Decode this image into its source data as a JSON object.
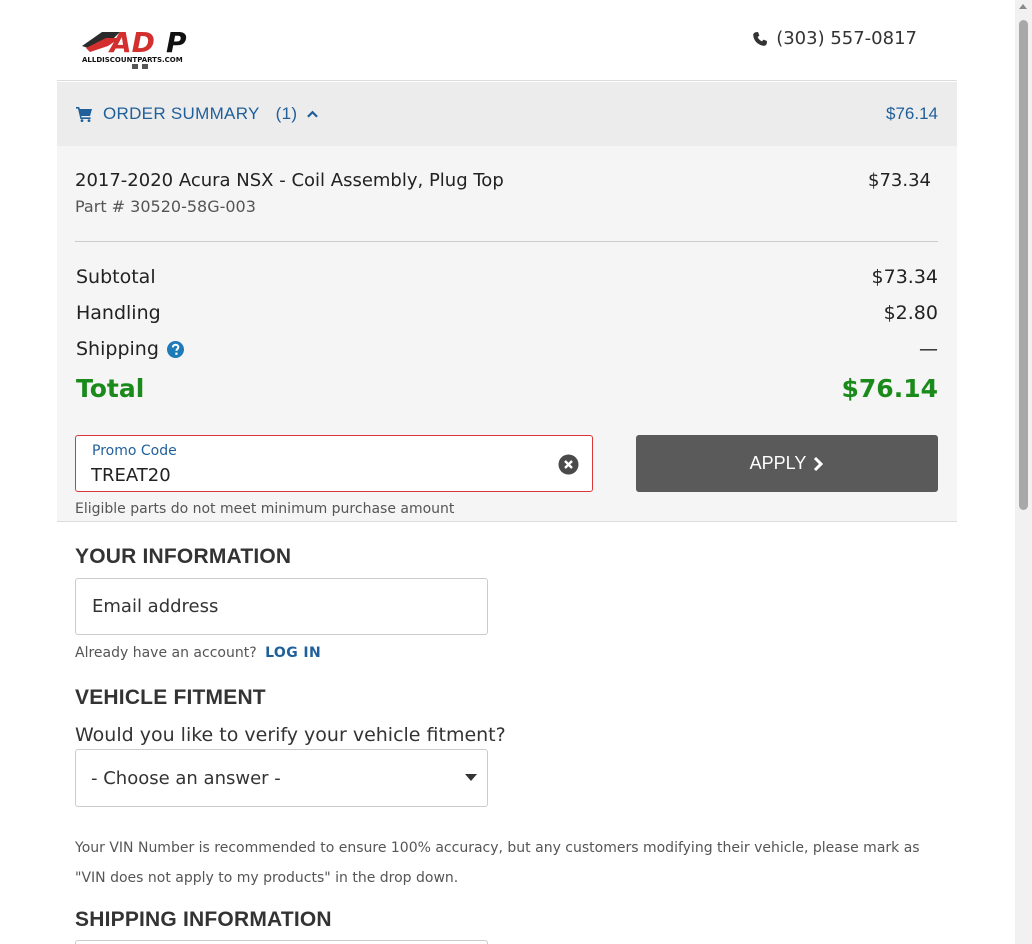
{
  "header": {
    "logo_text": "ADP",
    "logo_subtext": "ALLDISCOUNTPARTS.COM",
    "phone": "(303) 557-0817"
  },
  "order_summary": {
    "label": "ORDER SUMMARY",
    "count": "(1)",
    "total": "$76.14",
    "item": {
      "name": "2017-2020 Acura NSX - Coil Assembly, Plug Top",
      "part": "Part # 30520-58G-003",
      "price": "$73.34"
    },
    "subtotal_label": "Subtotal",
    "subtotal_value": "$73.34",
    "handling_label": "Handling",
    "handling_value": "$2.80",
    "shipping_label": "Shipping",
    "shipping_value": "—",
    "total_label": "Total",
    "total_value": "$76.14"
  },
  "promo": {
    "label": "Promo Code",
    "value": "TREAT20",
    "apply_label": "APPLY",
    "error": "Eligible parts do not meet minimum purchase amount"
  },
  "your_information": {
    "title": "YOUR INFORMATION",
    "email_placeholder": "Email address",
    "account_prompt": "Already have an account?",
    "login_label": "LOG IN"
  },
  "vehicle_fitment": {
    "title": "VEHICLE FITMENT",
    "question": "Would you like to verify your vehicle fitment?",
    "selected": "- Choose an answer -",
    "note": "Your VIN Number is recommended to ensure 100% accuracy, but any customers modifying their vehicle, please mark as \"VIN does not apply to my products\" in the drop down."
  },
  "shipping_information": {
    "title": "SHIPPING INFORMATION"
  },
  "colors": {
    "accent_blue": "#1f5f9a",
    "total_green": "#1a8a1a",
    "error_red": "#d9383a",
    "button_gray": "#5a5a5a"
  }
}
